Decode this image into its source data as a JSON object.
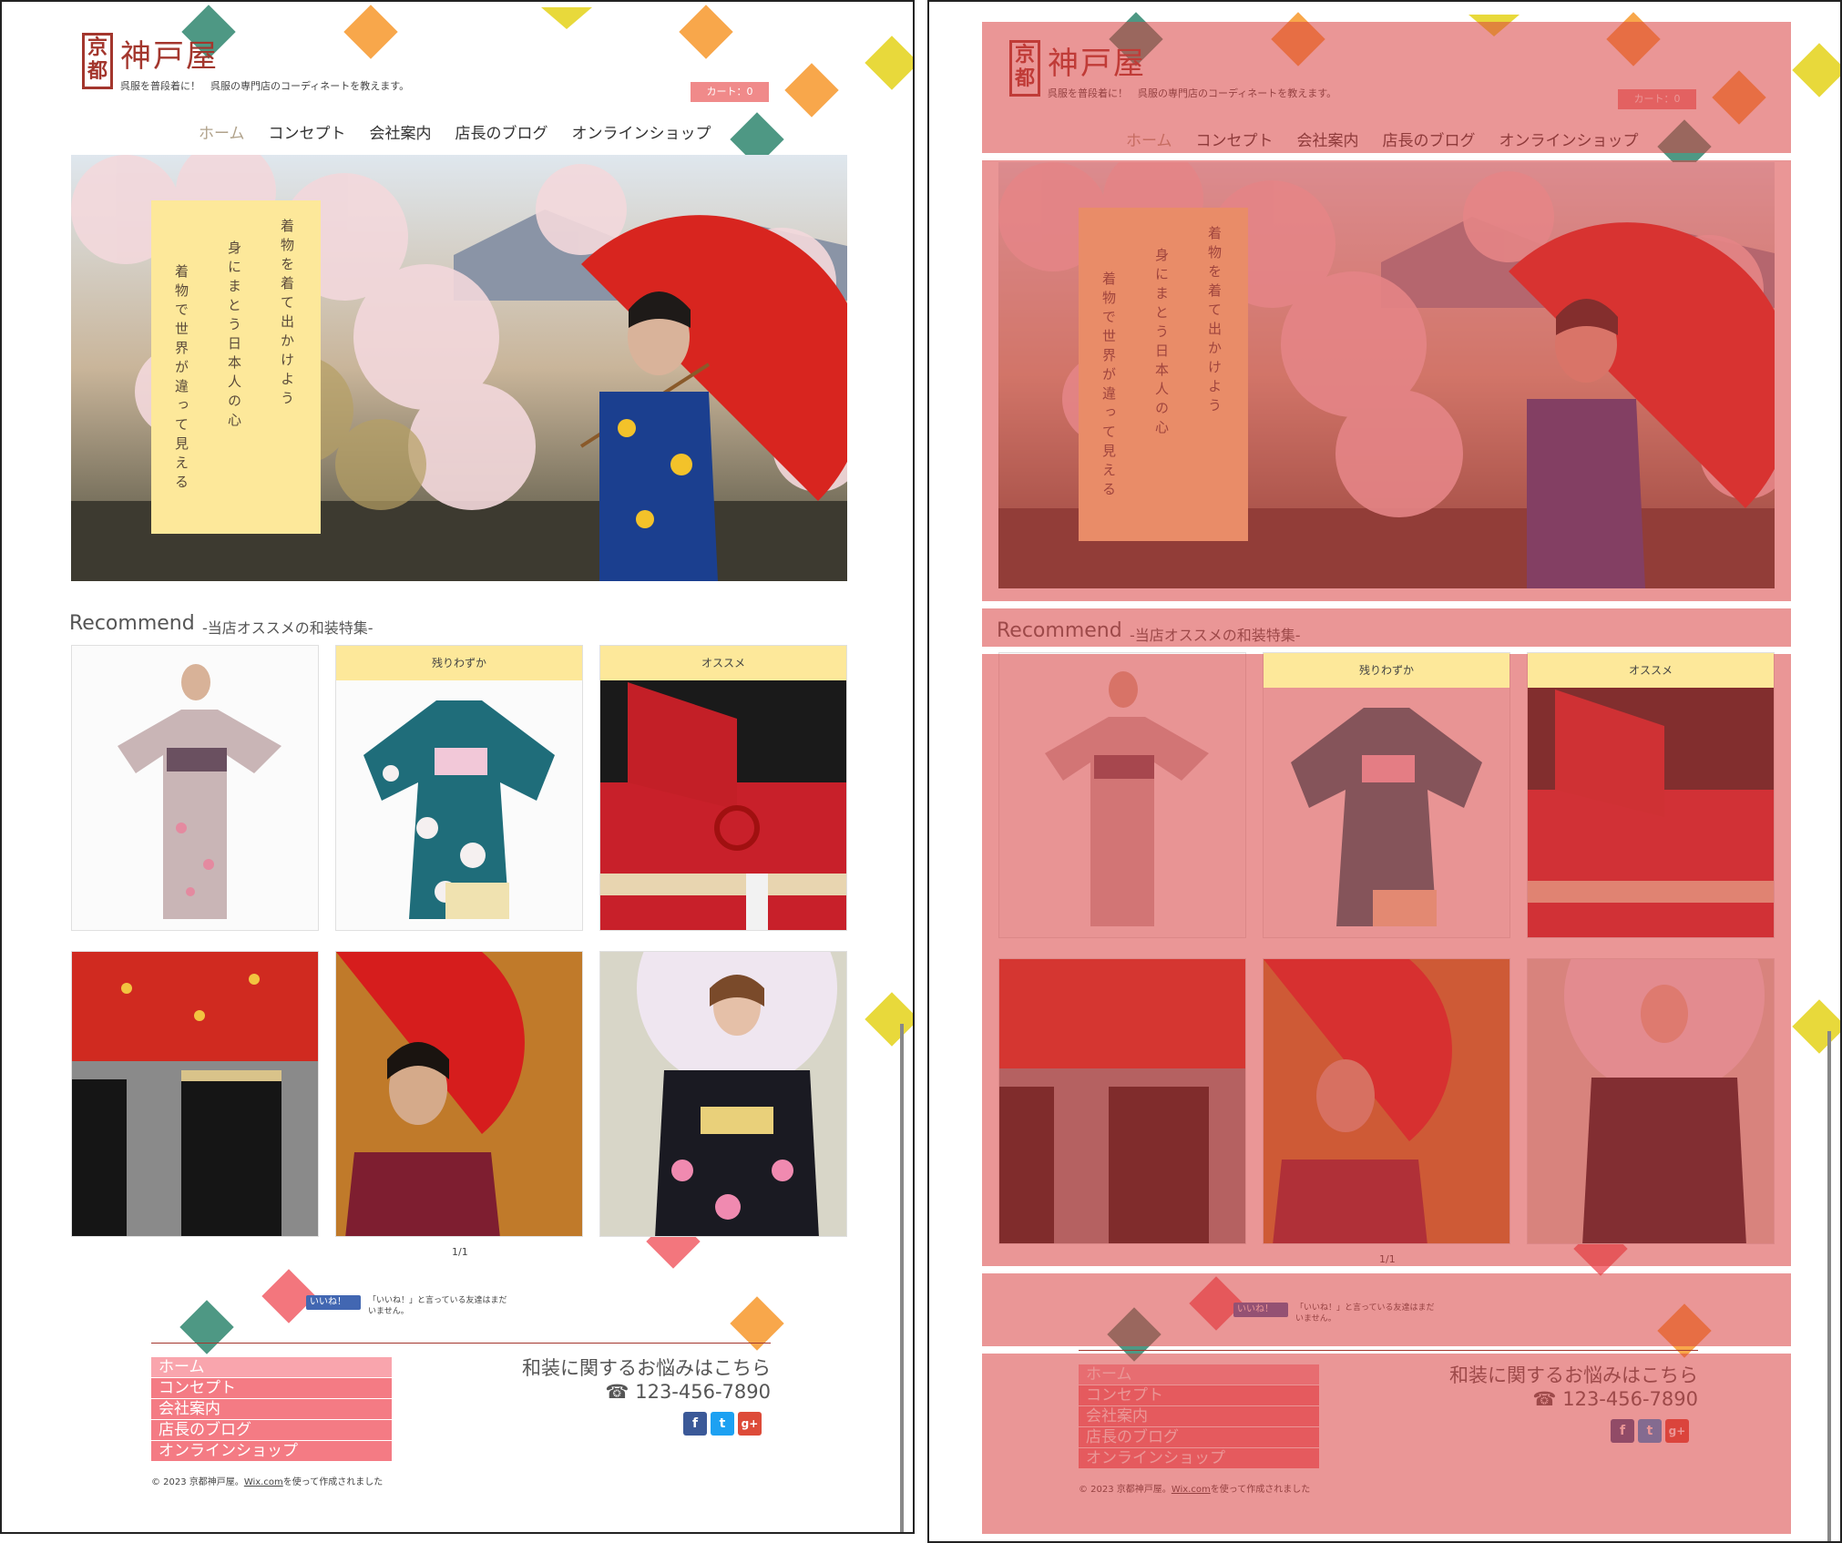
{
  "site": {
    "logo_seal": "京都",
    "logo_name": "神戸屋",
    "tagline": "呉服を普段着に！　呉服の専門店のコーディネートを教えます。",
    "cart_label": "カート：0"
  },
  "nav": {
    "items": [
      "ホーム",
      "コンセプト",
      "会社案内",
      "店長のブログ",
      "オンラインショップ"
    ]
  },
  "hero": {
    "lines": [
      "着物を着て出かけよう",
      "身にまとう日本人の心",
      "着物で世界が違って見える"
    ]
  },
  "recommend": {
    "title": "Recommend",
    "subtitle": "-当店オススメの和装特集-",
    "tags": [
      "",
      "残りわずか",
      "オススメ",
      "",
      "",
      ""
    ],
    "pager": "1/1"
  },
  "facebook": {
    "button": "いいね！",
    "text": "「いいね！」と言っている友達はまだいません。"
  },
  "footer": {
    "nav": [
      "ホーム",
      "コンセプト",
      "会社案内",
      "店長のブログ",
      "オンラインショップ"
    ],
    "contact_title": "和装に関するお悩みはこちら",
    "phone": "☎ 123-456-7890",
    "social": [
      "f",
      "t",
      "g+"
    ],
    "copyright_prefix": "© 2023 京都神戸屋。",
    "copyright_link": "Wix.com",
    "copyright_suffix": "を使って作成されました"
  },
  "colors": {
    "brand": "#a3362d",
    "accent_pink": "#f47b84",
    "card_yellow": "#fde89a",
    "overlay_red": "#d84040",
    "deco_green": "#3f8f7a",
    "deco_orange": "#f7a03c",
    "deco_yellow": "#e6d62a",
    "deco_pink": "#f26a72"
  }
}
